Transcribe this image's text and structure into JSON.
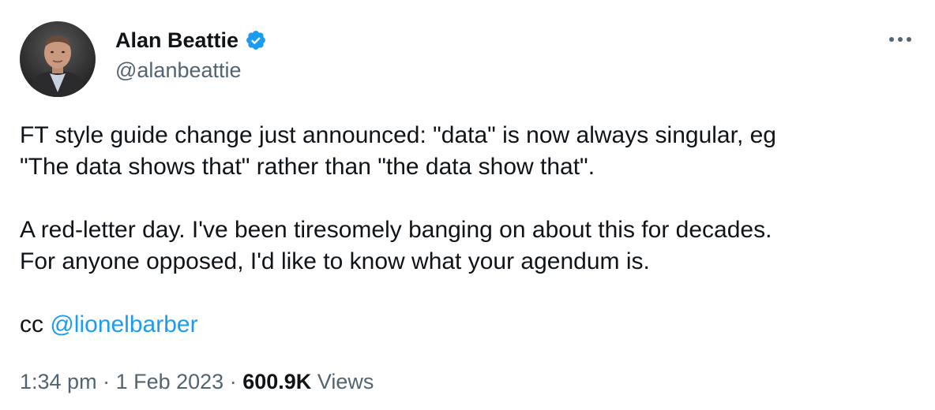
{
  "author": {
    "display_name": "Alan Beattie",
    "handle": "@alanbeattie",
    "verified_color": "#1d9bf0"
  },
  "tweet": {
    "line1": "FT style guide change just announced: \"data\" is now always singular, eg",
    "line2": "\"The data shows that\" rather than \"the data show that\".",
    "line3": "A red-letter day. I've been tiresomely banging on about this for decades.",
    "line4": "For anyone opposed, I'd like to know what your agendum is.",
    "cc_prefix": "cc ",
    "mention": "@lionelbarber"
  },
  "meta": {
    "time": "1:34 pm",
    "separator": "·",
    "date": "1 Feb 2023",
    "views_count": "600.9K",
    "views_label": "Views"
  },
  "icons": {
    "more": "more-options-icon",
    "verified": "verified-badge-icon",
    "avatar": "author-avatar"
  },
  "colors": {
    "text": "#0f1419",
    "secondary": "#536471",
    "link": "#1d9bf0"
  }
}
